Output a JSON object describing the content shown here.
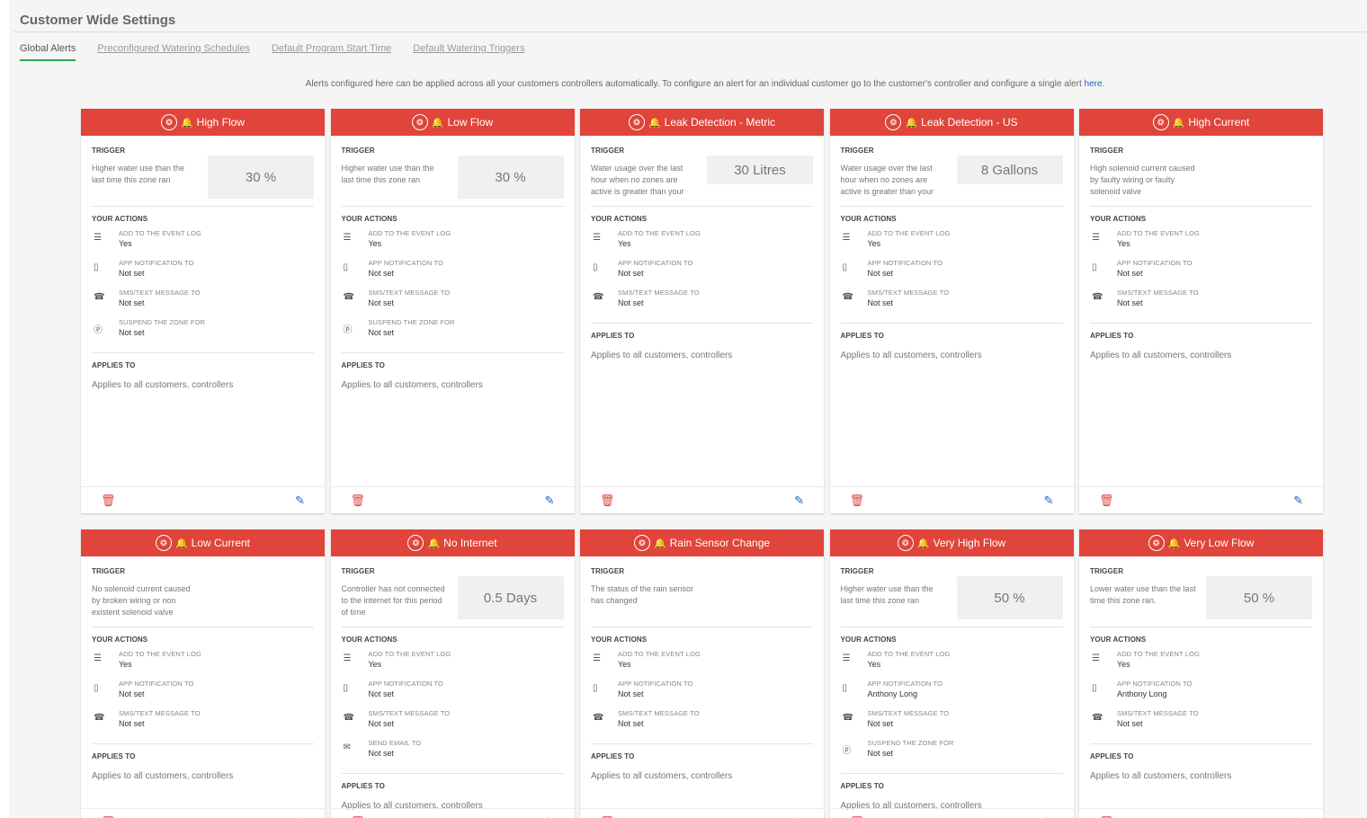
{
  "page": {
    "title": "Customer Wide Settings",
    "tabs": [
      "Global Alerts",
      "Preconfigured Watering Schedules",
      "Default Program Start Time",
      "Default Watering Triggers"
    ],
    "active_tab": 0,
    "info_text": "Alerts configured here can be applied across all your customers controllers automatically. To configure an alert for an individual customer go to the customer's controller and configure a single alert ",
    "info_link": "here",
    "info_tail": "."
  },
  "labels": {
    "trigger": "TRIGGER",
    "actions": "YOUR ACTIONS",
    "applies": "APPLIES TO"
  },
  "icons": {
    "header": "sprinkler-icon",
    "bell": "bell-icon",
    "event_log": "list-icon",
    "app": "mobile-icon",
    "sms": "phone-icon",
    "suspend": "pause-icon",
    "email": "email-icon",
    "delete": "trash-icon",
    "edit": "edit-icon"
  },
  "colors": {
    "header": "#e0443a",
    "active_tab": "#2ea84f",
    "link": "#1a66c7"
  },
  "cards": [
    {
      "title": "High Flow",
      "trigger_text": "Higher water use than the last time this zone ran",
      "trigger_value": "30 %",
      "actions": [
        {
          "icon": "event_log",
          "label": "ADD TO THE EVENT LOG",
          "value": "Yes"
        },
        {
          "icon": "app",
          "label": "APP NOTIFICATION TO",
          "value": "Not set"
        },
        {
          "icon": "sms",
          "label": "SMS/TEXT MESSAGE TO",
          "value": "Not set"
        },
        {
          "icon": "suspend",
          "label": "SUSPEND THE ZONE FOR",
          "value": "Not set"
        }
      ],
      "applies": "Applies to all customers, controllers"
    },
    {
      "title": "Low Flow",
      "trigger_text": "Higher water use than the last time this zone ran",
      "trigger_value": "30 %",
      "actions": [
        {
          "icon": "event_log",
          "label": "ADD TO THE EVENT LOG",
          "value": "Yes"
        },
        {
          "icon": "app",
          "label": "APP NOTIFICATION TO",
          "value": "Not set"
        },
        {
          "icon": "sms",
          "label": "SMS/TEXT MESSAGE TO",
          "value": "Not set"
        },
        {
          "icon": "suspend",
          "label": "SUSPEND THE ZONE FOR",
          "value": "Not set"
        }
      ],
      "applies": "Applies to all customers, controllers"
    },
    {
      "title": "Leak Detection - Metric",
      "trigger_text": "Water usage over the last hour when no zones are active is greater than your",
      "trigger_value": "30 Litres",
      "small_value": true,
      "actions": [
        {
          "icon": "event_log",
          "label": "ADD TO THE EVENT LOG",
          "value": "Yes"
        },
        {
          "icon": "app",
          "label": "APP NOTIFICATION TO",
          "value": "Not set"
        },
        {
          "icon": "sms",
          "label": "SMS/TEXT MESSAGE TO",
          "value": "Not set"
        }
      ],
      "applies": "Applies to all customers, controllers"
    },
    {
      "title": "Leak Detection - US",
      "trigger_text": "Water usage over the last hour when no zones are active is greater than your",
      "trigger_value": "8 Gallons",
      "small_value": true,
      "actions": [
        {
          "icon": "event_log",
          "label": "ADD TO THE EVENT LOG",
          "value": "Yes"
        },
        {
          "icon": "app",
          "label": "APP NOTIFICATION TO",
          "value": "Not set"
        },
        {
          "icon": "sms",
          "label": "SMS/TEXT MESSAGE TO",
          "value": "Not set"
        }
      ],
      "applies": "Applies to all customers, controllers"
    },
    {
      "title": "High Current",
      "trigger_text": "High solenoid current caused by faulty wiring or faulty solenoid valve",
      "trigger_value": "",
      "actions": [
        {
          "icon": "event_log",
          "label": "ADD TO THE EVENT LOG",
          "value": "Yes"
        },
        {
          "icon": "app",
          "label": "APP NOTIFICATION TO",
          "value": "Not set"
        },
        {
          "icon": "sms",
          "label": "SMS/TEXT MESSAGE TO",
          "value": "Not set"
        }
      ],
      "applies": "Applies to all customers, controllers"
    },
    {
      "title": "Low Current",
      "trigger_text": "No solenoid current caused by broken wiring or non existent solenoid valve",
      "trigger_value": "",
      "actions": [
        {
          "icon": "event_log",
          "label": "ADD TO THE EVENT LOG",
          "value": "Yes"
        },
        {
          "icon": "app",
          "label": "APP NOTIFICATION TO",
          "value": "Not set"
        },
        {
          "icon": "sms",
          "label": "SMS/TEXT MESSAGE TO",
          "value": "Not set"
        }
      ],
      "applies": "Applies to all customers, controllers"
    },
    {
      "title": "No Internet",
      "trigger_text": "Controller has not connected to the internet for this period of time",
      "trigger_value": "0.5 Days",
      "actions": [
        {
          "icon": "event_log",
          "label": "ADD TO THE EVENT LOG",
          "value": "Yes"
        },
        {
          "icon": "app",
          "label": "APP NOTIFICATION TO",
          "value": "Not set"
        },
        {
          "icon": "sms",
          "label": "SMS/TEXT MESSAGE TO",
          "value": "Not set"
        },
        {
          "icon": "email",
          "label": "SEND EMAIL TO",
          "value": "Not set"
        }
      ],
      "applies": "Applies to all customers, controllers"
    },
    {
      "title": "Rain Sensor Change",
      "trigger_text": "The status of the rain sensor has changed",
      "trigger_value": "",
      "actions": [
        {
          "icon": "event_log",
          "label": "ADD TO THE EVENT LOG",
          "value": "Yes"
        },
        {
          "icon": "app",
          "label": "APP NOTIFICATION TO",
          "value": "Not set"
        },
        {
          "icon": "sms",
          "label": "SMS/TEXT MESSAGE TO",
          "value": "Not set"
        }
      ],
      "applies": "Applies to all customers, controllers"
    },
    {
      "title": "Very High Flow",
      "trigger_text": "Higher water use than the last time this zone ran",
      "trigger_value": "50 %",
      "actions": [
        {
          "icon": "event_log",
          "label": "ADD TO THE EVENT LOG",
          "value": "Yes"
        },
        {
          "icon": "app",
          "label": "APP NOTIFICATION TO",
          "value": "Anthony Long"
        },
        {
          "icon": "sms",
          "label": "SMS/TEXT MESSAGE TO",
          "value": "Not set"
        },
        {
          "icon": "suspend",
          "label": "SUSPEND THE ZONE FOR",
          "value": "Not set"
        }
      ],
      "applies": "Applies to all customers, controllers"
    },
    {
      "title": "Very Low Flow",
      "trigger_text": "Lower water use than the last time this zone ran.",
      "trigger_value": "50 %",
      "actions": [
        {
          "icon": "event_log",
          "label": "ADD TO THE EVENT LOG",
          "value": "Yes"
        },
        {
          "icon": "app",
          "label": "APP NOTIFICATION TO",
          "value": "Anthony Long"
        },
        {
          "icon": "sms",
          "label": "SMS/TEXT MESSAGE TO",
          "value": "Not set"
        }
      ],
      "applies": "Applies to all customers, controllers"
    }
  ]
}
